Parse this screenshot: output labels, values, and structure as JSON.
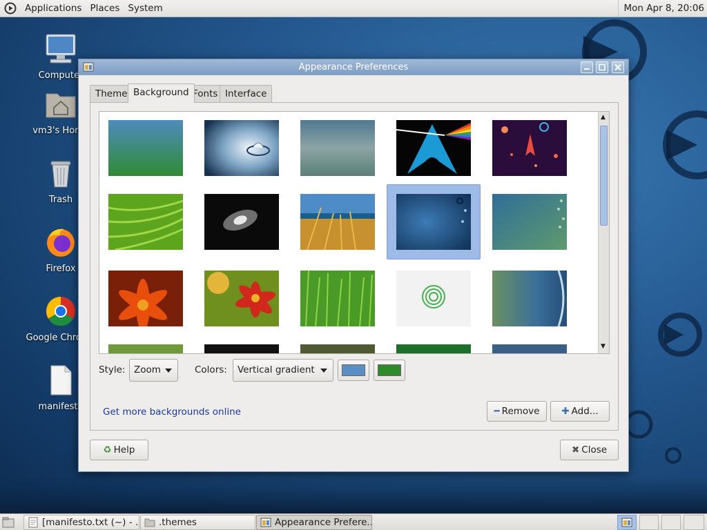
{
  "top_panel": {
    "menus": [
      "Applications",
      "Places",
      "System"
    ],
    "clock": "Mon Apr  8, 20:06"
  },
  "desktop_icons": [
    {
      "label": "Computer",
      "icon": "computer-icon"
    },
    {
      "label": "vm3's Home",
      "icon": "home-folder-icon"
    },
    {
      "label": "Trash",
      "icon": "trash-icon"
    },
    {
      "label": "Firefox",
      "icon": "firefox-icon"
    },
    {
      "label": "Google Chrome",
      "icon": "chrome-icon"
    },
    {
      "label": "manifesto",
      "icon": "document-icon"
    }
  ],
  "window": {
    "title": "Appearance Preferences",
    "tabs": [
      "Theme",
      "Background",
      "Fonts",
      "Interface"
    ],
    "active_tab": "Background",
    "style_label": "Style:",
    "style_value": "Zoom",
    "colors_label": "Colors:",
    "colors_value": "Vertical gradient",
    "color_primary": "#5b8ec2",
    "color_secondary": "#2e8a2a",
    "more_link": "Get more backgrounds online",
    "remove_label": "Remove",
    "add_label": "Add...",
    "help_label": "Help",
    "close_label": "Close",
    "selected_wallpaper": "blue-bubbles"
  },
  "wallpapers": [
    "blue-green-gradient",
    "water-drop",
    "teal-haze",
    "arch-prism",
    "space-rockets",
    "green-leaf",
    "galaxy",
    "wheat-grass",
    "blue-bubbles",
    "teal-bubbles",
    "orange-flower",
    "red-marigold",
    "green-grass",
    "spiral-logo",
    "green-blue-wave"
  ],
  "taskbar": {
    "tasks": [
      "[manifesto.txt (~) - ...",
      ".themes",
      "Appearance Prefere..."
    ],
    "active_task": 2
  }
}
